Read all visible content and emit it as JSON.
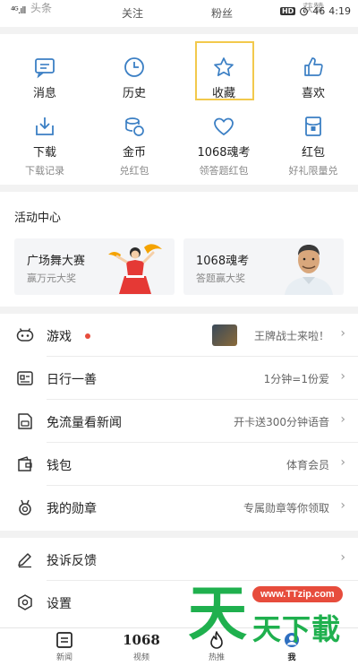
{
  "status_bar": {
    "signal": "⁴ᴳ.ıll",
    "top_tabs": [
      "头条",
      "关注",
      "粉丝",
      "获赞"
    ],
    "hd": "HD",
    "battery": "46",
    "time": "4:19"
  },
  "grid": {
    "row1": [
      {
        "label": "消息",
        "icon": "message-icon"
      },
      {
        "label": "历史",
        "icon": "clock-icon"
      },
      {
        "label": "收藏",
        "icon": "star-icon"
      },
      {
        "label": "喜欢",
        "icon": "thumbs-up-icon"
      }
    ],
    "row2": [
      {
        "label": "下载",
        "sub": "下载记录",
        "icon": "download-icon"
      },
      {
        "label": "金币",
        "sub": "兑红包",
        "icon": "coin-icon"
      },
      {
        "label": "1068魂考",
        "sub": "领答题红包",
        "icon": "heart-icon"
      },
      {
        "label": "红包",
        "sub": "好礼限量兑",
        "icon": "red-packet-icon"
      }
    ]
  },
  "activity": {
    "title": "活动中心",
    "cards": [
      {
        "title": "广场舞大赛",
        "sub": "赢万元大奖"
      },
      {
        "title": "1068魂考",
        "sub": "答题赢大奖"
      }
    ]
  },
  "list": [
    {
      "label": "游戏",
      "value": "王牌战士来啦！",
      "icon": "gamepad-icon"
    },
    {
      "label": "日行一善",
      "value": "1分钟=1份爱",
      "icon": "charity-icon"
    },
    {
      "label": "免流量看新闻",
      "value": "开卡送300分钟语音",
      "icon": "sim-card-icon"
    },
    {
      "label": "钱包",
      "value": "体育会员",
      "icon": "wallet-icon"
    },
    {
      "label": "我的勋章",
      "value": "专属勋章等你领取",
      "icon": "medal-icon"
    }
  ],
  "list2": [
    {
      "label": "投诉反馈",
      "icon": "pen-icon"
    },
    {
      "label": "设置",
      "icon": "settings-icon"
    }
  ],
  "bottom_nav": [
    {
      "label": "新闻",
      "icon": "news-icon"
    },
    {
      "label": "视频",
      "icon": "video-icon",
      "glyph": "1068"
    },
    {
      "label": "热推",
      "icon": "fire-icon"
    },
    {
      "label": "我",
      "icon": "me-icon",
      "active": true
    }
  ],
  "watermark": {
    "big": "天",
    "text": "天下載",
    "url": "www.TTzip.com"
  },
  "colors": {
    "icon_blue": "#3b7fc4",
    "dot_red": "#e74c3c",
    "watermark_green": "#1fb04e"
  }
}
